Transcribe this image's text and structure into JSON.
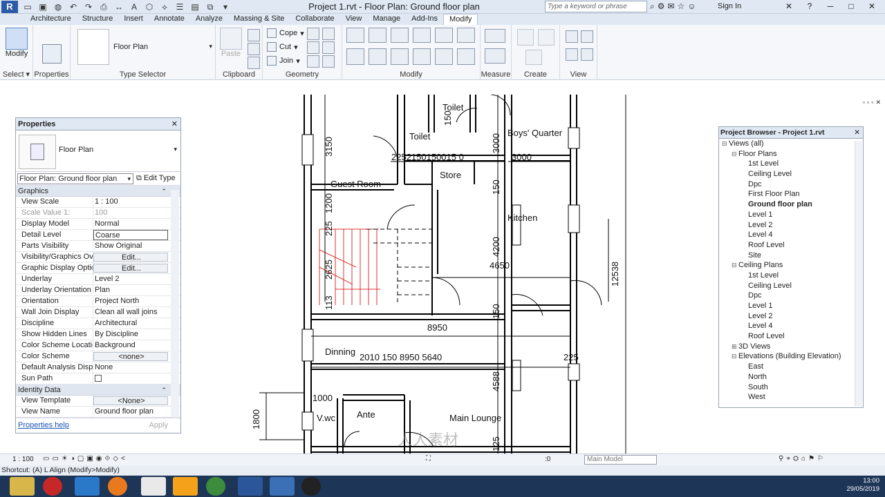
{
  "title_bar": {
    "app_logo": "R",
    "title": "Project 1.rvt - Floor Plan: Ground floor plan",
    "search_placeholder": "Type a keyword or phrase",
    "sign_in": "Sign In"
  },
  "ribbon_tabs": [
    "Architecture",
    "Structure",
    "Insert",
    "Annotate",
    "Analyze",
    "Massing & Site",
    "Collaborate",
    "View",
    "Manage",
    "Add-Ins",
    "Modify"
  ],
  "active_tab": "Modify",
  "ribbon": {
    "select": {
      "modify": "Modify",
      "select_label": "Select",
      "properties": "Properties"
    },
    "type_selector": {
      "name": "Floor Plan",
      "label": "Type Selector"
    },
    "clipboard": {
      "paste": "Paste",
      "label": "Clipboard"
    },
    "geometry": {
      "cope": "Cope",
      "cut": "Cut",
      "join": "Join",
      "label": "Geometry"
    },
    "modify_label": "Modify",
    "measure_label": "Measure",
    "create_label": "Create",
    "view_label": "View"
  },
  "properties": {
    "title": "Properties",
    "type_name": "Floor Plan",
    "instance": "Floor Plan: Ground floor plan",
    "edit_type": "Edit Type",
    "categories": {
      "graphics": "Graphics",
      "identity": "Identity Data"
    },
    "rows": [
      {
        "k": "View Scale",
        "v": "1 : 100"
      },
      {
        "k": "Scale Value    1:",
        "v": "100"
      },
      {
        "k": "Display Model",
        "v": "Normal"
      },
      {
        "k": "Detail Level",
        "v": "Coarse"
      },
      {
        "k": "Parts Visibility",
        "v": "Show Original"
      },
      {
        "k": "Visibility/Graphics Ov...",
        "v": "Edit..."
      },
      {
        "k": "Graphic Display Optio...",
        "v": "Edit..."
      },
      {
        "k": "Underlay",
        "v": "Level 2"
      },
      {
        "k": "Underlay Orientation",
        "v": "Plan"
      },
      {
        "k": "Orientation",
        "v": "Project North"
      },
      {
        "k": "Wall Join Display",
        "v": "Clean all wall joins"
      },
      {
        "k": "Discipline",
        "v": "Architectural"
      },
      {
        "k": "Show Hidden Lines",
        "v": "By Discipline"
      },
      {
        "k": "Color Scheme Location",
        "v": "Background"
      },
      {
        "k": "Color Scheme",
        "v": "<none>"
      },
      {
        "k": "Default Analysis Displ...",
        "v": "None"
      },
      {
        "k": "Sun Path",
        "v": ""
      }
    ],
    "identity_rows": [
      {
        "k": "View Template",
        "v": "<None>"
      },
      {
        "k": "View Name",
        "v": "Ground floor plan"
      }
    ],
    "help": "Properties help",
    "apply": "Apply"
  },
  "browser": {
    "title": "Project Browser - Project 1.rvt",
    "nodes": [
      {
        "t": "Views (all)",
        "lvl": 0,
        "exp": "−"
      },
      {
        "t": "Floor Plans",
        "lvl": 1,
        "exp": "−"
      },
      {
        "t": "1st Level",
        "lvl": 2
      },
      {
        "t": "Ceiling Level",
        "lvl": 2
      },
      {
        "t": "Dpc",
        "lvl": 2
      },
      {
        "t": "First Floor Plan",
        "lvl": 2
      },
      {
        "t": "Ground floor plan",
        "lvl": 2,
        "bold": true
      },
      {
        "t": "Level 1",
        "lvl": 2
      },
      {
        "t": "Level 2",
        "lvl": 2
      },
      {
        "t": "Level 4",
        "lvl": 2
      },
      {
        "t": "Roof Level",
        "lvl": 2
      },
      {
        "t": "Site",
        "lvl": 2
      },
      {
        "t": "Ceiling Plans",
        "lvl": 1,
        "exp": "−"
      },
      {
        "t": "1st Level",
        "lvl": 2
      },
      {
        "t": "Ceiling Level",
        "lvl": 2
      },
      {
        "t": "Dpc",
        "lvl": 2
      },
      {
        "t": "Level 1",
        "lvl": 2
      },
      {
        "t": "Level 2",
        "lvl": 2
      },
      {
        "t": "Level 4",
        "lvl": 2
      },
      {
        "t": "Roof Level",
        "lvl": 2
      },
      {
        "t": "3D Views",
        "lvl": 1,
        "exp": "+"
      },
      {
        "t": "Elevations (Building Elevation)",
        "lvl": 1,
        "exp": "−"
      },
      {
        "t": "East",
        "lvl": 2
      },
      {
        "t": "North",
        "lvl": 2
      },
      {
        "t": "South",
        "lvl": 2
      },
      {
        "t": "West",
        "lvl": 2
      }
    ]
  },
  "plan_labels": {
    "toilet1": "Toilet",
    "toilet2": "Toilet",
    "boys_quarter": "Boys' Quarter",
    "store": "Store",
    "guest_room": "Guest Room",
    "kitchen": "Kitchen",
    "dinning": "Dinning",
    "vwc": "V.wc",
    "ante": "Ante",
    "main_lounge": "Main Lounge",
    "d3150": "3150",
    "d150a": "150",
    "d3000a": "3000",
    "d3000b": "3000",
    "dchain": "2252150150015 0",
    "d150b": "150",
    "d1200": "1200",
    "d225a": "225",
    "d4200": "4200",
    "d4650": "4650",
    "d2625": "2625",
    "d12538": "12538",
    "d113": "113",
    "d150c": "150",
    "d8950a": "8950",
    "dchain2": "2010    150    8950    5640",
    "d225b": "225",
    "d4588": "4588",
    "d1000": "1000",
    "d1800": "1800",
    "d125": "125"
  },
  "view_bar": {
    "scale": "1 : 100",
    "model": "Main Model",
    "zero": ":0"
  },
  "status": "Shortcut: (A) L Align (Modify>Modify)",
  "clock": {
    "time": "13:00",
    "date": "29/05/2019"
  },
  "watermark": "人人素材"
}
